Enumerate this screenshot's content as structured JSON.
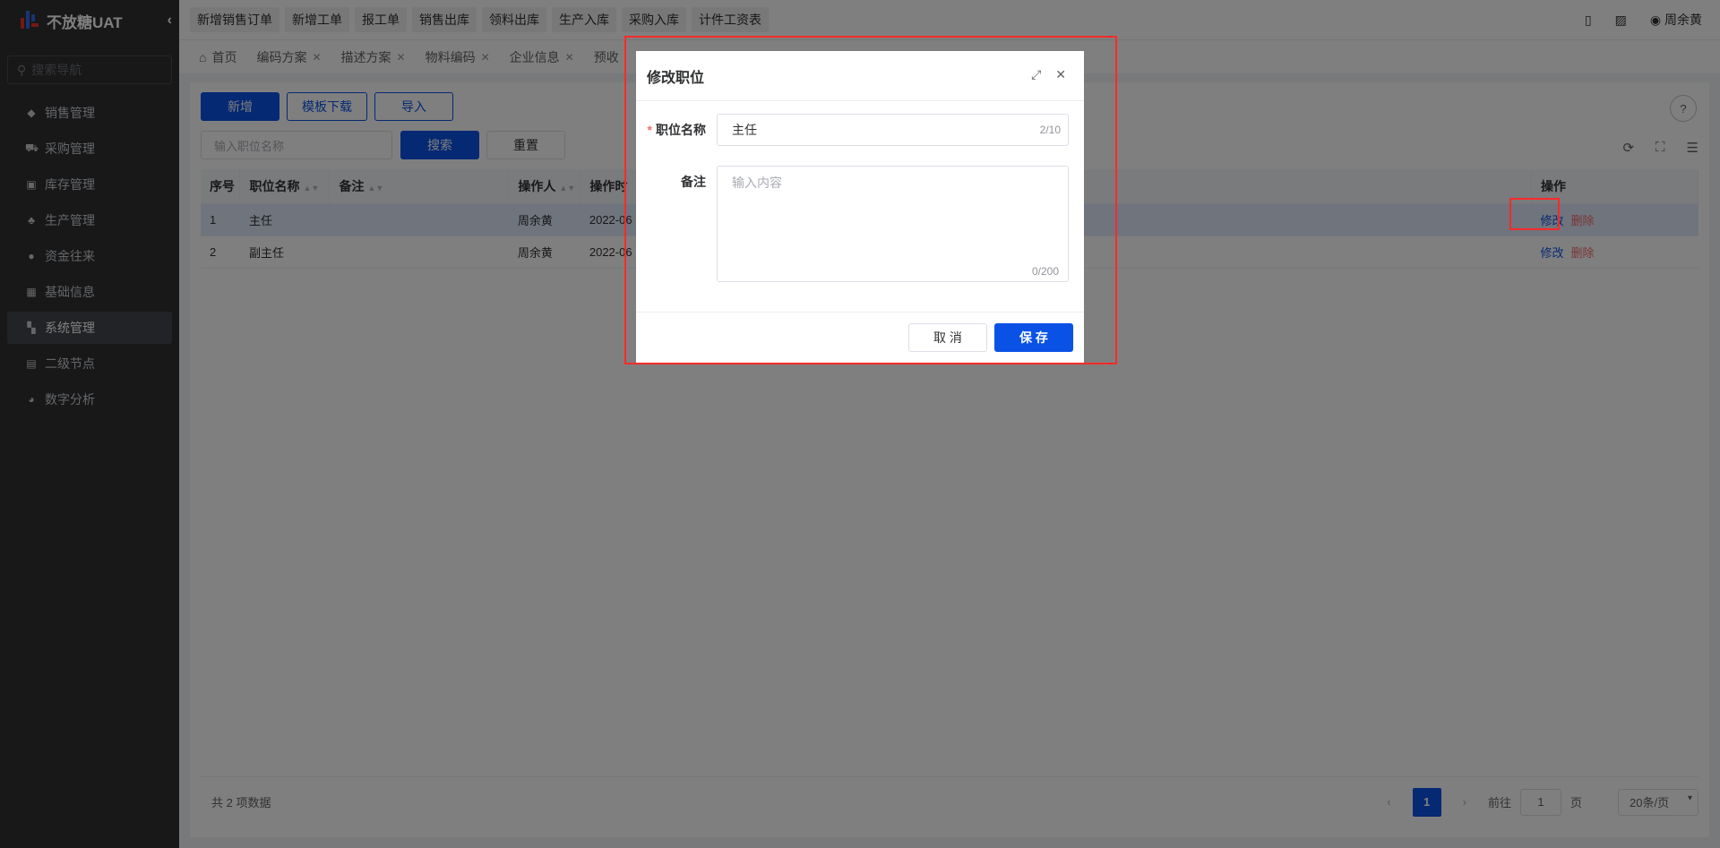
{
  "app": {
    "title": "不放糖UAT",
    "collapse_icon": "chevron-left-icon"
  },
  "sidebar": {
    "search_placeholder": "搜索导航",
    "items": [
      {
        "label": "销售管理",
        "icon": "tag-icon"
      },
      {
        "label": "采购管理",
        "icon": "cart-icon"
      },
      {
        "label": "库存管理",
        "icon": "box-icon"
      },
      {
        "label": "生产管理",
        "icon": "factory-icon"
      },
      {
        "label": "资金往来",
        "icon": "coin-icon"
      },
      {
        "label": "基础信息",
        "icon": "grid-icon"
      },
      {
        "label": "系统管理",
        "icon": "apps-icon",
        "active": true
      },
      {
        "label": "二级节点",
        "icon": "doc-icon"
      },
      {
        "label": "数字分析",
        "icon": "pie-icon"
      }
    ]
  },
  "topbar": {
    "quick_links": [
      "新增销售订单",
      "新增工单",
      "报工单",
      "销售出库",
      "领料出库",
      "生产入库",
      "采购入库",
      "计件工资表"
    ],
    "user": "周余黄"
  },
  "tabs": [
    {
      "label": "首页",
      "closable": false
    },
    {
      "label": "编码方案",
      "closable": true
    },
    {
      "label": "描述方案",
      "closable": true
    },
    {
      "label": "物料编码",
      "closable": true
    },
    {
      "label": "企业信息",
      "closable": true
    },
    {
      "label": "预收",
      "closable": false
    }
  ],
  "toolbar": {
    "add": "新增",
    "template_download": "模板下载",
    "import": "导入",
    "search_placeholder": "输入职位名称",
    "search": "搜索",
    "reset": "重置"
  },
  "table": {
    "headers": [
      "序号",
      "职位名称",
      "备注",
      "操作人",
      "操作时",
      "操作"
    ],
    "rows": [
      {
        "index": "1",
        "name": "主任",
        "remark": "",
        "operator": "周余黄",
        "time": "2022-06",
        "edit": "修改",
        "delete": "删除"
      },
      {
        "index": "2",
        "name": "副主任",
        "remark": "",
        "operator": "周余黄",
        "time": "2022-06",
        "edit": "修改",
        "delete": "删除"
      }
    ]
  },
  "pagination": {
    "total": "共 2 项数据",
    "current_page": "1",
    "goto_label": "前往",
    "goto_value": "1",
    "page_unit": "页",
    "page_size": "20条/页"
  },
  "dialog": {
    "title": "修改职位",
    "name_label": "职位名称",
    "name_value": "主任",
    "name_count": "2/10",
    "remark_label": "备注",
    "remark_placeholder": "输入内容",
    "remark_count": "0/200",
    "cancel": "取 消",
    "save": "保 存"
  },
  "colors": {
    "primary": "#0a52e6",
    "danger": "#f56c6c",
    "annotation": "#ff2a2a",
    "sidebar": "#303133"
  }
}
